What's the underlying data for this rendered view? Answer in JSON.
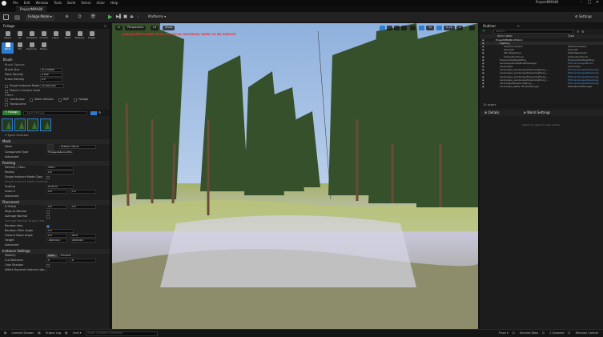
{
  "titlebar": {
    "menu": [
      "File",
      "Edit",
      "Window",
      "Tools",
      "Build",
      "Select",
      "Actor",
      "Help"
    ],
    "project": "ProjectMMA80",
    "tab": "ProjectMMA80"
  },
  "toolbar": {
    "mode": "Foliage Mode",
    "platforms": "Platforms",
    "settings": "Settings"
  },
  "foliage_panel": {
    "tab": "Foliage",
    "tools": [
      "Select",
      "All",
      "Deselect",
      "Invalid",
      "Lasso",
      "Paint",
      "Reapply",
      "Single",
      "Fill",
      "Remove",
      "Erase"
    ],
    "brush_section": "Brush",
    "brush_options_label": "Brush Options",
    "brush_size_label": "Brush Size",
    "brush_size": "512.00000",
    "paint_density_label": "Paint Density",
    "paint_density": "0.500",
    "erase_density_label": "Erase Density",
    "erase_density": "0.0",
    "single_instance_label": "Single Instance Mode",
    "single_instance_value": "All Selected",
    "place_cursor_label": "Place in Current Level",
    "filters_label": "Filters",
    "filters": [
      "Landscape",
      "Static Meshes",
      "BSP",
      "Foliage",
      "Translucent"
    ],
    "add_foliage": "+ Foliage",
    "search_placeholder": "Search Foliage",
    "types_selected": "4 Types Selected"
  },
  "details": {
    "mesh_section": "Mesh",
    "mesh_label": "Mesh",
    "mesh_value": "Multiple Values",
    "component_type_label": "Component Type",
    "component_type_value": "FoliageInstancedSt...",
    "advanced": "Advanced",
    "painting_section": "Painting",
    "density_label": "Density / 1Kuu",
    "density_value": "100.0",
    "radius_label": "Radius",
    "radius_value": "0.0",
    "single_instance_label": "Single Instance Mode Copy",
    "single_instance_override": "Single Instance Mode Override",
    "scaling_label": "Scaling",
    "scaling_value": "Uniform",
    "scale_x_label": "Scale X",
    "scale_min": "0.6",
    "scale_max": "1.0",
    "advanced2": "Advanced",
    "placement_section": "Placement",
    "z_offset_label": "Z Offset",
    "z_min": "0.0",
    "z_max": "0.0",
    "align_normal_label": "Align to Normal",
    "average_normal_label": "Average Normal",
    "average_normal_single": "Average Normal Single Com...",
    "random_yaw_label": "Random Yaw",
    "random_pitch_label": "Random Pitch Angle",
    "random_pitch_value": "0.0",
    "ground_slope_label": "Ground Slope Angle",
    "slope_min": "0.0",
    "slope_max": "90.0",
    "height_label": "Height",
    "height_min": "-262144.0",
    "height_max": "262144.0",
    "advanced3": "Advanced",
    "instance_section": "Instance Settings",
    "mobility_label": "Mobility",
    "mobility_static": "Static",
    "mobility_movable": "Movable",
    "cull_label": "Cull Distance",
    "cull_min": "0",
    "cull_max": "0",
    "cast_shadow_label": "Cast Shadow",
    "affect_label": "Affect Dynamic Indirect Ligh..."
  },
  "viewport": {
    "perspective": "Perspective",
    "lit": "Lit",
    "show": "Show",
    "warning": "LANDSCAPE LAYER WITH PHYSICAL MATERIAL NEED TO BE REBUILT",
    "fov": "10",
    "snap": "0.25",
    "cam": "1"
  },
  "outliner": {
    "tab": "Outliner",
    "search_placeholder": "Search...",
    "col_label": "Item Label",
    "col_type": "Type",
    "rows": [
      {
        "label": "ProjectMMA80 (Editor)",
        "type": "",
        "indent": 0
      },
      {
        "label": "Lighting",
        "type": "",
        "indent": 1
      },
      {
        "label": "SkyAtmosphere",
        "type": "SkyAtmosphere",
        "indent": 2
      },
      {
        "label": "SkyLight",
        "type": "SkyLight",
        "indent": 2
      },
      {
        "label": "SM_SkySphere",
        "type": "StaticMeshActor",
        "indent": 2
      },
      {
        "label": "VolumetricCloud",
        "type": "VolumetricCloud",
        "indent": 2
      },
      {
        "label": "ExponentialHeightFog",
        "type": "ExponentialHeightFog",
        "indent": 1
      },
      {
        "label": "LandscapeGrassBrushManager",
        "type": "Edit LandscapeBrush",
        "indent": 1
      },
      {
        "label": "Landscape",
        "type": "Landscape",
        "indent": 1
      },
      {
        "label": "Landscape_LandscapeStreamingProxy_...",
        "type": "Edit LandscapeStreaming",
        "indent": 1
      },
      {
        "label": "Landscape_LandscapeStreamingProxy_...",
        "type": "Edit LandscapeStreaming",
        "indent": 1
      },
      {
        "label": "Landscape_LandscapeStreamingProxy_...",
        "type": "Edit LandscapeStreaming",
        "indent": 1
      },
      {
        "label": "Landscape_LandscapeStreamingProxy_...",
        "type": "Edit LandscapeStreaming",
        "indent": 1
      },
      {
        "label": "LandscapeStreamingProxy_...",
        "type": "Edit LandscapeStreaming",
        "indent": 1
      },
      {
        "label": "Landscape_Water BrushManager",
        "type": "WaterBrushManager",
        "indent": 1
      }
    ],
    "actors_label": "15 actors"
  },
  "details_panel": {
    "tab": "Details",
    "world_settings": "World Settings",
    "empty": "Select an object to view details."
  },
  "statusbar": {
    "content_drawer": "Content Drawer",
    "output_log": "Output Log",
    "cmd": "Cmd",
    "cmd_placeholder": "Enter Console Command",
    "trace": "Trace",
    "derived_data": "Derived Data",
    "unsaved": "1 Unsaved",
    "revision": "Revision Control"
  }
}
